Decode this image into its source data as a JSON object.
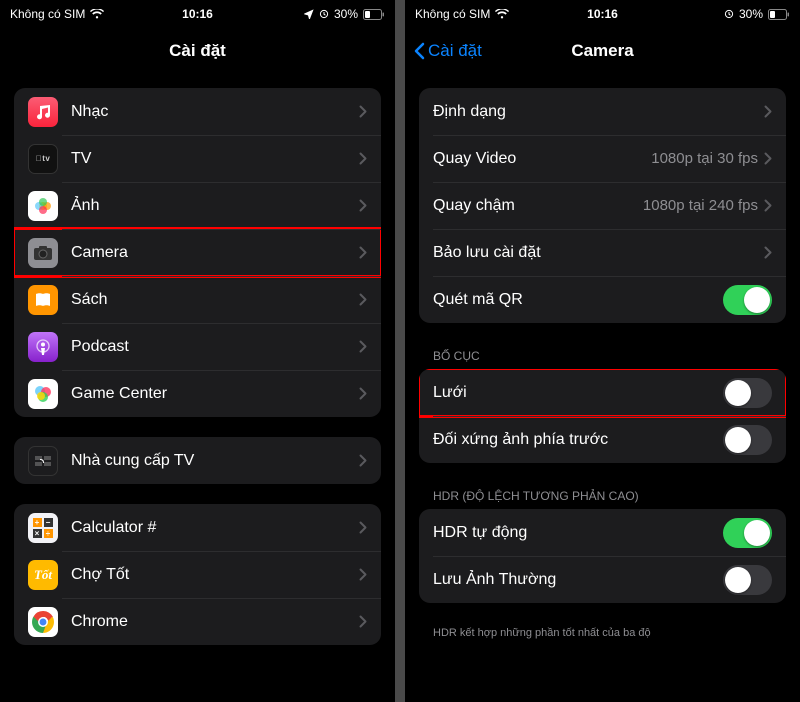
{
  "status": {
    "carrier": "Không có SIM",
    "time": "10:16",
    "battery_pct": "30%"
  },
  "left": {
    "title": "Cài đặt",
    "groups": [
      {
        "rows": [
          {
            "icon": "music-icon",
            "label": "Nhạc"
          },
          {
            "icon": "tv-icon",
            "label": "TV"
          },
          {
            "icon": "photos-icon",
            "label": "Ảnh"
          },
          {
            "icon": "camera-icon",
            "label": "Camera",
            "highlight": true
          },
          {
            "icon": "books-icon",
            "label": "Sách"
          },
          {
            "icon": "podcast-icon",
            "label": "Podcast"
          },
          {
            "icon": "gamecenter-icon",
            "label": "Game Center"
          }
        ]
      },
      {
        "rows": [
          {
            "icon": "tvprovider-icon",
            "label": "Nhà cung cấp TV"
          }
        ]
      },
      {
        "rows": [
          {
            "icon": "calculator-icon",
            "label": "Calculator #"
          },
          {
            "icon": "chotot-icon",
            "label": "Chợ Tốt"
          },
          {
            "icon": "chrome-icon",
            "label": "Chrome"
          }
        ]
      }
    ]
  },
  "right": {
    "back_label": "Cài đặt",
    "title": "Camera",
    "sections": [
      {
        "rows": [
          {
            "label": "Định dạng",
            "type": "nav"
          },
          {
            "label": "Quay Video",
            "detail": "1080p tại 30 fps",
            "type": "nav"
          },
          {
            "label": "Quay chậm",
            "detail": "1080p tại 240 fps",
            "type": "nav"
          },
          {
            "label": "Bảo lưu cài đặt",
            "type": "nav"
          },
          {
            "label": "Quét mã QR",
            "type": "switch",
            "on": true
          }
        ]
      },
      {
        "header": "BỐ CỤC",
        "rows": [
          {
            "label": "Lưới",
            "type": "switch",
            "on": false,
            "highlight": true
          },
          {
            "label": "Đối xứng ảnh phía trước",
            "type": "switch",
            "on": false
          }
        ]
      },
      {
        "header": "HDR (ĐỘ LỆCH TƯƠNG PHẢN CAO)",
        "rows": [
          {
            "label": "HDR tự động",
            "type": "switch",
            "on": true
          },
          {
            "label": "Lưu Ảnh Thường",
            "type": "switch",
            "on": false
          }
        ],
        "footnote": "HDR kết hợp những phần tốt nhất của ba độ"
      }
    ]
  }
}
